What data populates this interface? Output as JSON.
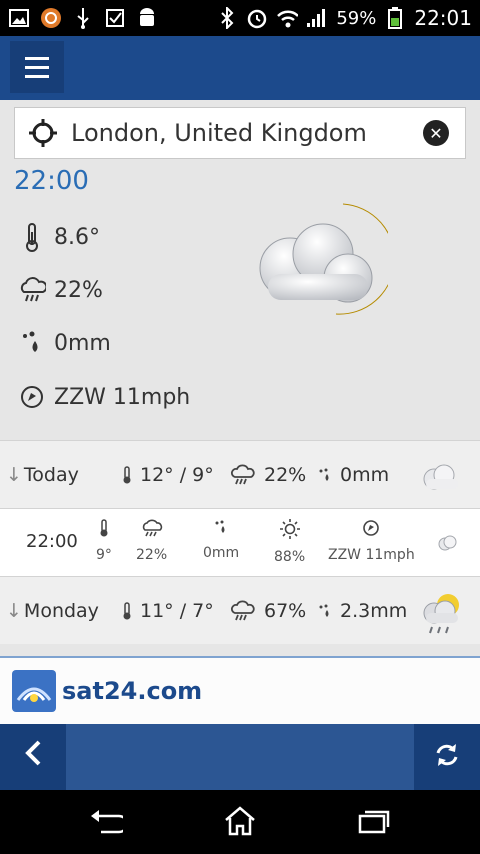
{
  "status_bar": {
    "battery": "59%",
    "time": "22:01",
    "icons": [
      "image-icon",
      "app-icon",
      "usb-icon",
      "checkbox-icon",
      "android-icon",
      "bluetooth-icon",
      "alarm-icon",
      "wifi-icon",
      "signal-icon",
      "battery-icon"
    ]
  },
  "search": {
    "location": "London, United Kingdom"
  },
  "current": {
    "time": "22:00",
    "temperature": "8.6°",
    "rain_chance": "22%",
    "precipitation": "0mm",
    "wind": "ZZW 11mph"
  },
  "forecast": {
    "today": {
      "day": "Today",
      "temp": "12° / 9°",
      "rain": "22%",
      "precip": "0mm"
    },
    "hourly": {
      "time": "22:00",
      "temp": "9°",
      "rain": "22%",
      "precip": "0mm",
      "humidity": "88%",
      "wind": "ZZW 11mph"
    },
    "monday": {
      "day": "Monday",
      "temp": "11° / 7°",
      "rain": "67%",
      "precip": "2.3mm"
    }
  },
  "ad": {
    "brand": "sat24.com"
  },
  "colors": {
    "appbar": "#1c4a8c",
    "accent_time": "#2a6db5",
    "status_bar": "#000000"
  }
}
